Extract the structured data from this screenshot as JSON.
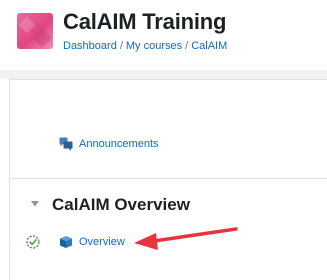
{
  "header": {
    "course_title": "CalAIM Training",
    "breadcrumb": {
      "items": [
        "Dashboard",
        "My courses",
        "CalAIM"
      ],
      "separator": "/"
    }
  },
  "course_content": {
    "announcements_label": "Announcements",
    "section": {
      "title": "CalAIM Overview",
      "activities": [
        {
          "label": "Overview",
          "icon": "book-icon",
          "completion": "completion-check-icon"
        }
      ]
    }
  },
  "colors": {
    "link": "#0f6cbf",
    "heading": "#1d2125",
    "annotation_arrow": "#e8343c",
    "course_image": "#e0467f",
    "band": "#f2f2f2"
  }
}
